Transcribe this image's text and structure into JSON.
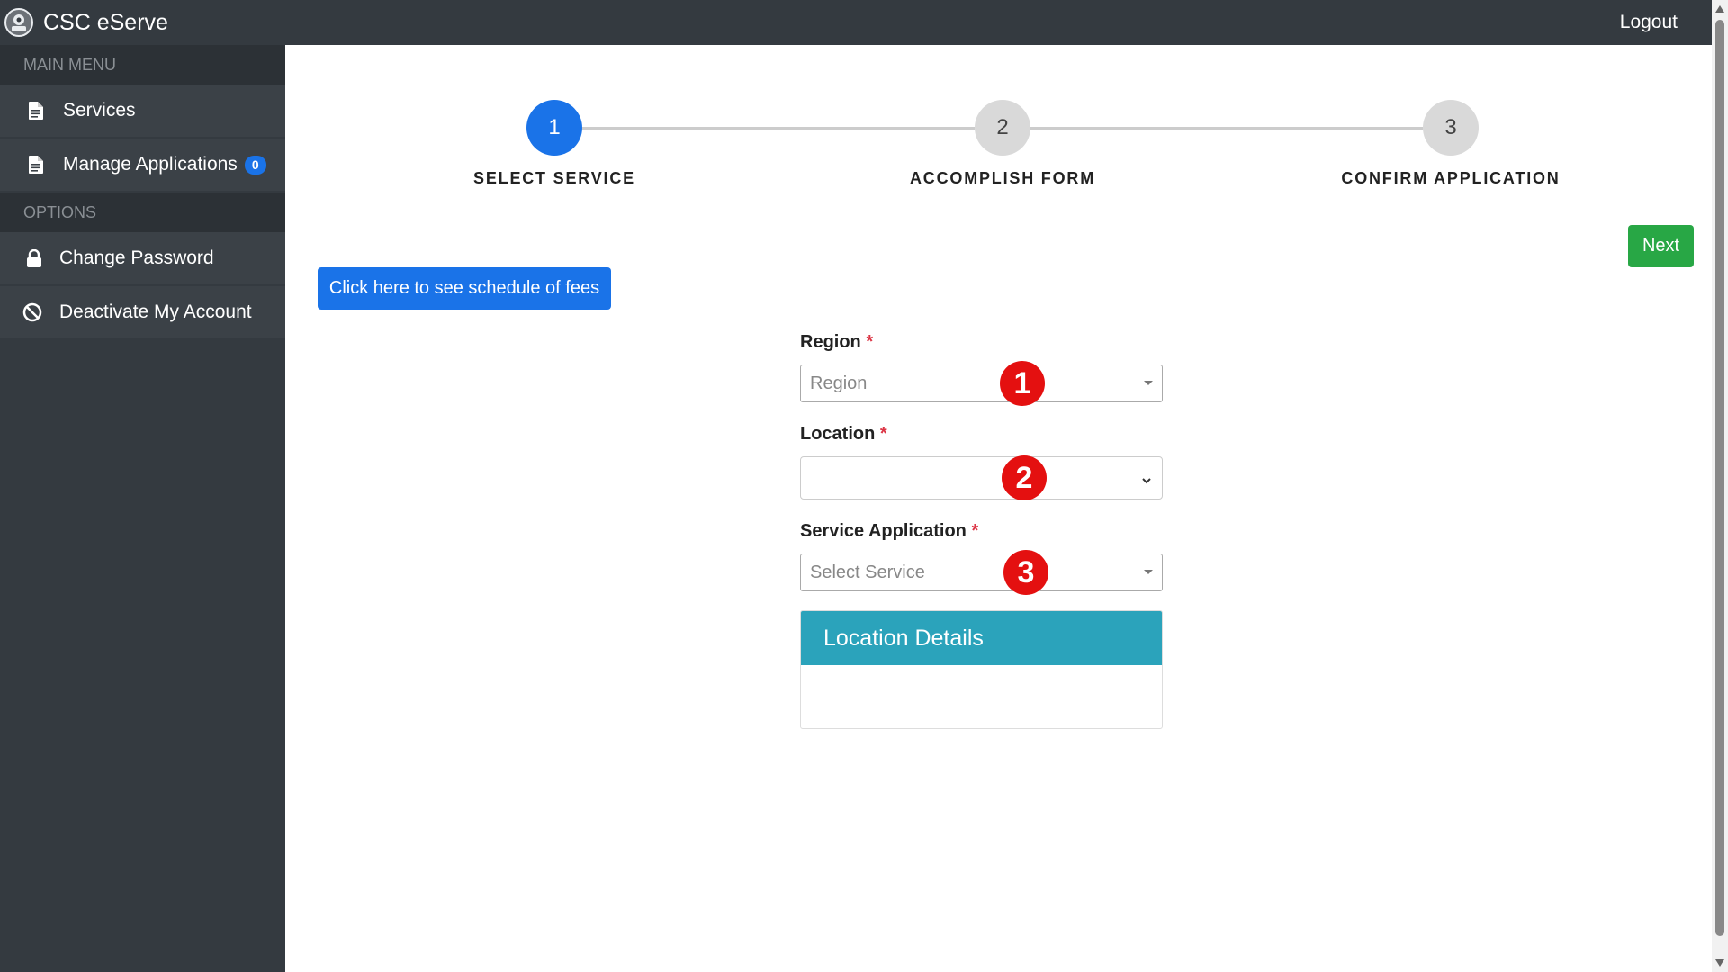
{
  "header": {
    "title": "CSC eServe",
    "logout_label": "Logout",
    "logo_icon": "seal-logo-icon",
    "bg_color": "#343a40"
  },
  "sidebar": {
    "main_menu_header": "MAIN MENU",
    "options_header": "OPTIONS",
    "items": [
      {
        "label": "Services",
        "icon": "document-icon"
      },
      {
        "label": "Manage Applications",
        "icon": "document-icon",
        "badge": "0"
      },
      {
        "label": "Change Password",
        "icon": "lock-icon"
      },
      {
        "label": "Deactivate My Account",
        "icon": "ban-icon"
      }
    ]
  },
  "stepper": {
    "steps": [
      {
        "number": "1",
        "label": "SELECT SERVICE",
        "active": true
      },
      {
        "number": "2",
        "label": "ACCOMPLISH FORM",
        "active": false
      },
      {
        "number": "3",
        "label": "CONFIRM APPLICATION",
        "active": false
      }
    ],
    "active_color": "#1a73e8"
  },
  "buttons": {
    "next_label": "Next",
    "fees_label": "Click here to see schedule of fees"
  },
  "form": {
    "required_mark": "*",
    "region": {
      "label": "Region",
      "placeholder": "Region",
      "value": ""
    },
    "location": {
      "label": "Location",
      "value": ""
    },
    "service": {
      "label": "Service Application",
      "placeholder": "Select Service",
      "value": ""
    }
  },
  "annotations": [
    "1",
    "2",
    "3"
  ],
  "location_details": {
    "title": "Location Details",
    "header_color": "#2ba3bb"
  }
}
